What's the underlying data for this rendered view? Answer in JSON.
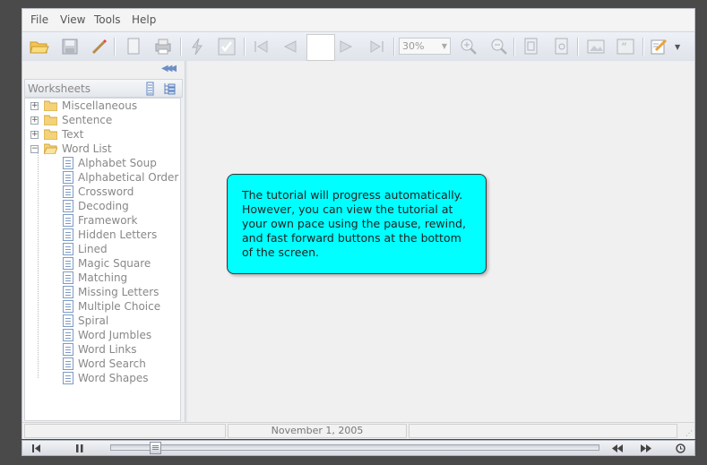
{
  "menu": {
    "file": "File",
    "view": "View",
    "tools": "Tools",
    "help": "Help"
  },
  "toolbar": {
    "zoom_value": "30%"
  },
  "sidebar": {
    "header_title": "Worksheets",
    "folders": [
      "Miscellaneous",
      "Sentence",
      "Text",
      "Word List"
    ],
    "word_list_items": [
      "Alphabet Soup",
      "Alphabetical Order",
      "Crossword",
      "Decoding",
      "Framework",
      "Hidden Letters",
      "Lined",
      "Magic Square",
      "Matching",
      "Missing Letters",
      "Multiple Choice",
      "Spiral",
      "Word Jumbles",
      "Word Links",
      "Word Search",
      "Word Shapes"
    ]
  },
  "callout": {
    "text": "The tutorial will progress automatically. However, you can view the tutorial at your own pace using the pause, rewind, and fast forward buttons at the bottom of the screen."
  },
  "status": {
    "date": "November 1, 2005"
  },
  "colors": {
    "callout_bg": "#00ffff",
    "folder": "#f4d27a"
  }
}
